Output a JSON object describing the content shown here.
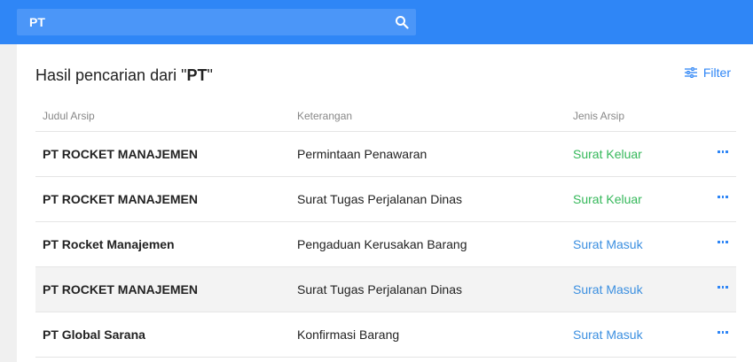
{
  "search": {
    "value": "PT"
  },
  "header": {
    "title_prefix": "Hasil pencarian dari \"",
    "query": "PT",
    "title_suffix": "\"",
    "filter_label": "Filter"
  },
  "table": {
    "columns": [
      "Judul Arsip",
      "Keterangan",
      "Jenis Arsip"
    ],
    "rows": [
      {
        "judul": "PT ROCKET MANAJEMEN",
        "keterangan": "Permintaan Penawaran",
        "jenis": "Surat Keluar",
        "type": "keluar"
      },
      {
        "judul": "PT ROCKET MANAJEMEN",
        "keterangan": "Surat Tugas Perjalanan Dinas",
        "jenis": "Surat Keluar",
        "type": "keluar"
      },
      {
        "judul": "PT Rocket Manajemen",
        "keterangan": "Pengaduan Kerusakan Barang",
        "jenis": "Surat Masuk",
        "type": "masuk"
      },
      {
        "judul": "PT ROCKET MANAJEMEN",
        "keterangan": "Surat Tugas Perjalanan Dinas",
        "jenis": "Surat Masuk",
        "type": "masuk"
      },
      {
        "judul": "PT Global Sarana",
        "keterangan": "Konfirmasi Barang",
        "jenis": "Surat Masuk",
        "type": "masuk"
      }
    ]
  },
  "colors": {
    "primary": "#2f86f6",
    "keluar": "#35b85a",
    "masuk": "#3b8fe0"
  },
  "icons": [
    "search-icon",
    "filter-icon",
    "more-icon"
  ]
}
